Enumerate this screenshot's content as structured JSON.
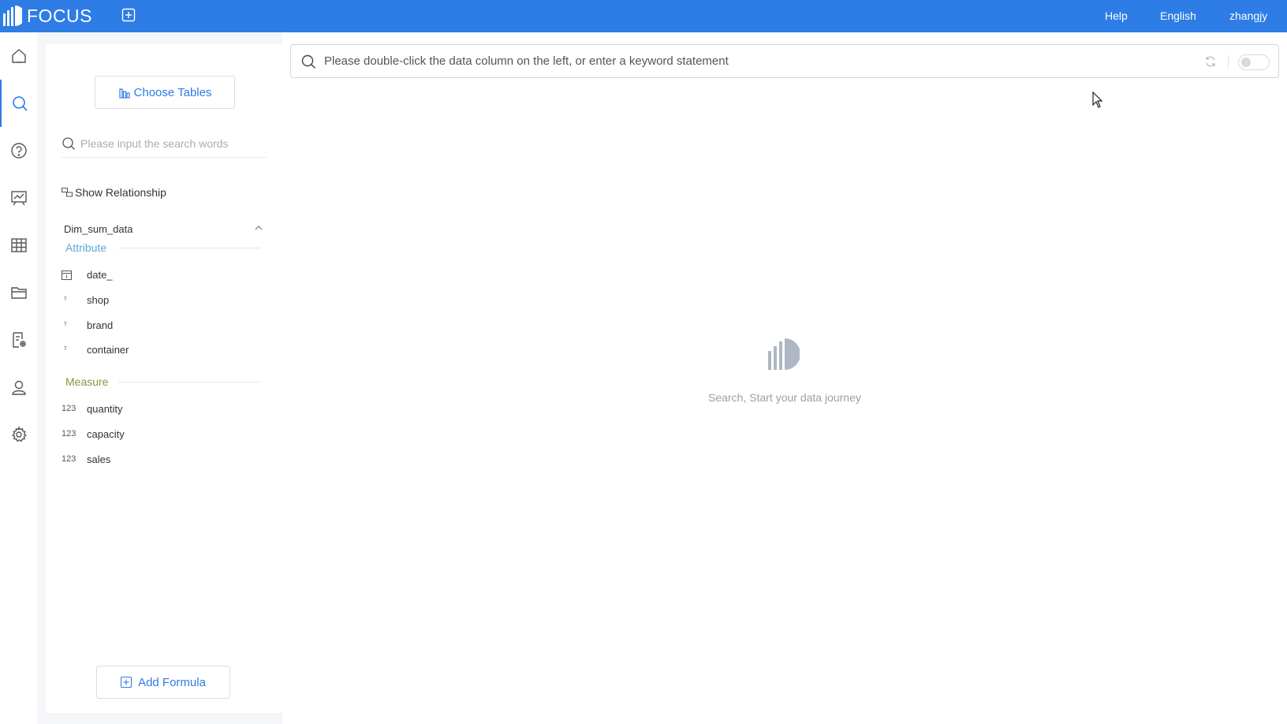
{
  "app": {
    "logo_text": "FOCUS",
    "accent_color": "#2e7ce6"
  },
  "topbar": {
    "help": "Help",
    "language": "English",
    "user": "zhangjy"
  },
  "rail": {
    "items": [
      {
        "name": "home-icon",
        "active": false
      },
      {
        "name": "search-icon",
        "active": true
      },
      {
        "name": "question-icon",
        "active": false
      },
      {
        "name": "dashboard-icon",
        "active": false
      },
      {
        "name": "table-icon",
        "active": false
      },
      {
        "name": "folder-icon",
        "active": false
      },
      {
        "name": "report-settings-icon",
        "active": false
      },
      {
        "name": "user-icon",
        "active": false
      },
      {
        "name": "gear-icon",
        "active": false
      }
    ]
  },
  "panel": {
    "choose_tables": "Choose Tables",
    "search_placeholder": "Please input the search words",
    "show_relationship": "Show Relationship",
    "table_name": "Dim_sum_data",
    "attribute_title": "Attribute",
    "attribute_color": "#5aa7d8",
    "measure_title": "Measure",
    "measure_color": "#7f9a3c",
    "attributes": [
      {
        "icon": "date",
        "label": "date_"
      },
      {
        "icon": "text",
        "label": "shop"
      },
      {
        "icon": "text",
        "label": "brand"
      },
      {
        "icon": "text",
        "label": "container"
      }
    ],
    "measures": [
      {
        "icon": "123",
        "label": "quantity"
      },
      {
        "icon": "123",
        "label": "capacity"
      },
      {
        "icon": "123",
        "label": "sales"
      }
    ],
    "add_formula": "Add Formula"
  },
  "main": {
    "search_placeholder": "Please double-click the data column on the left, or enter a keyword statement",
    "empty_text": "Search, Start your data journey"
  }
}
